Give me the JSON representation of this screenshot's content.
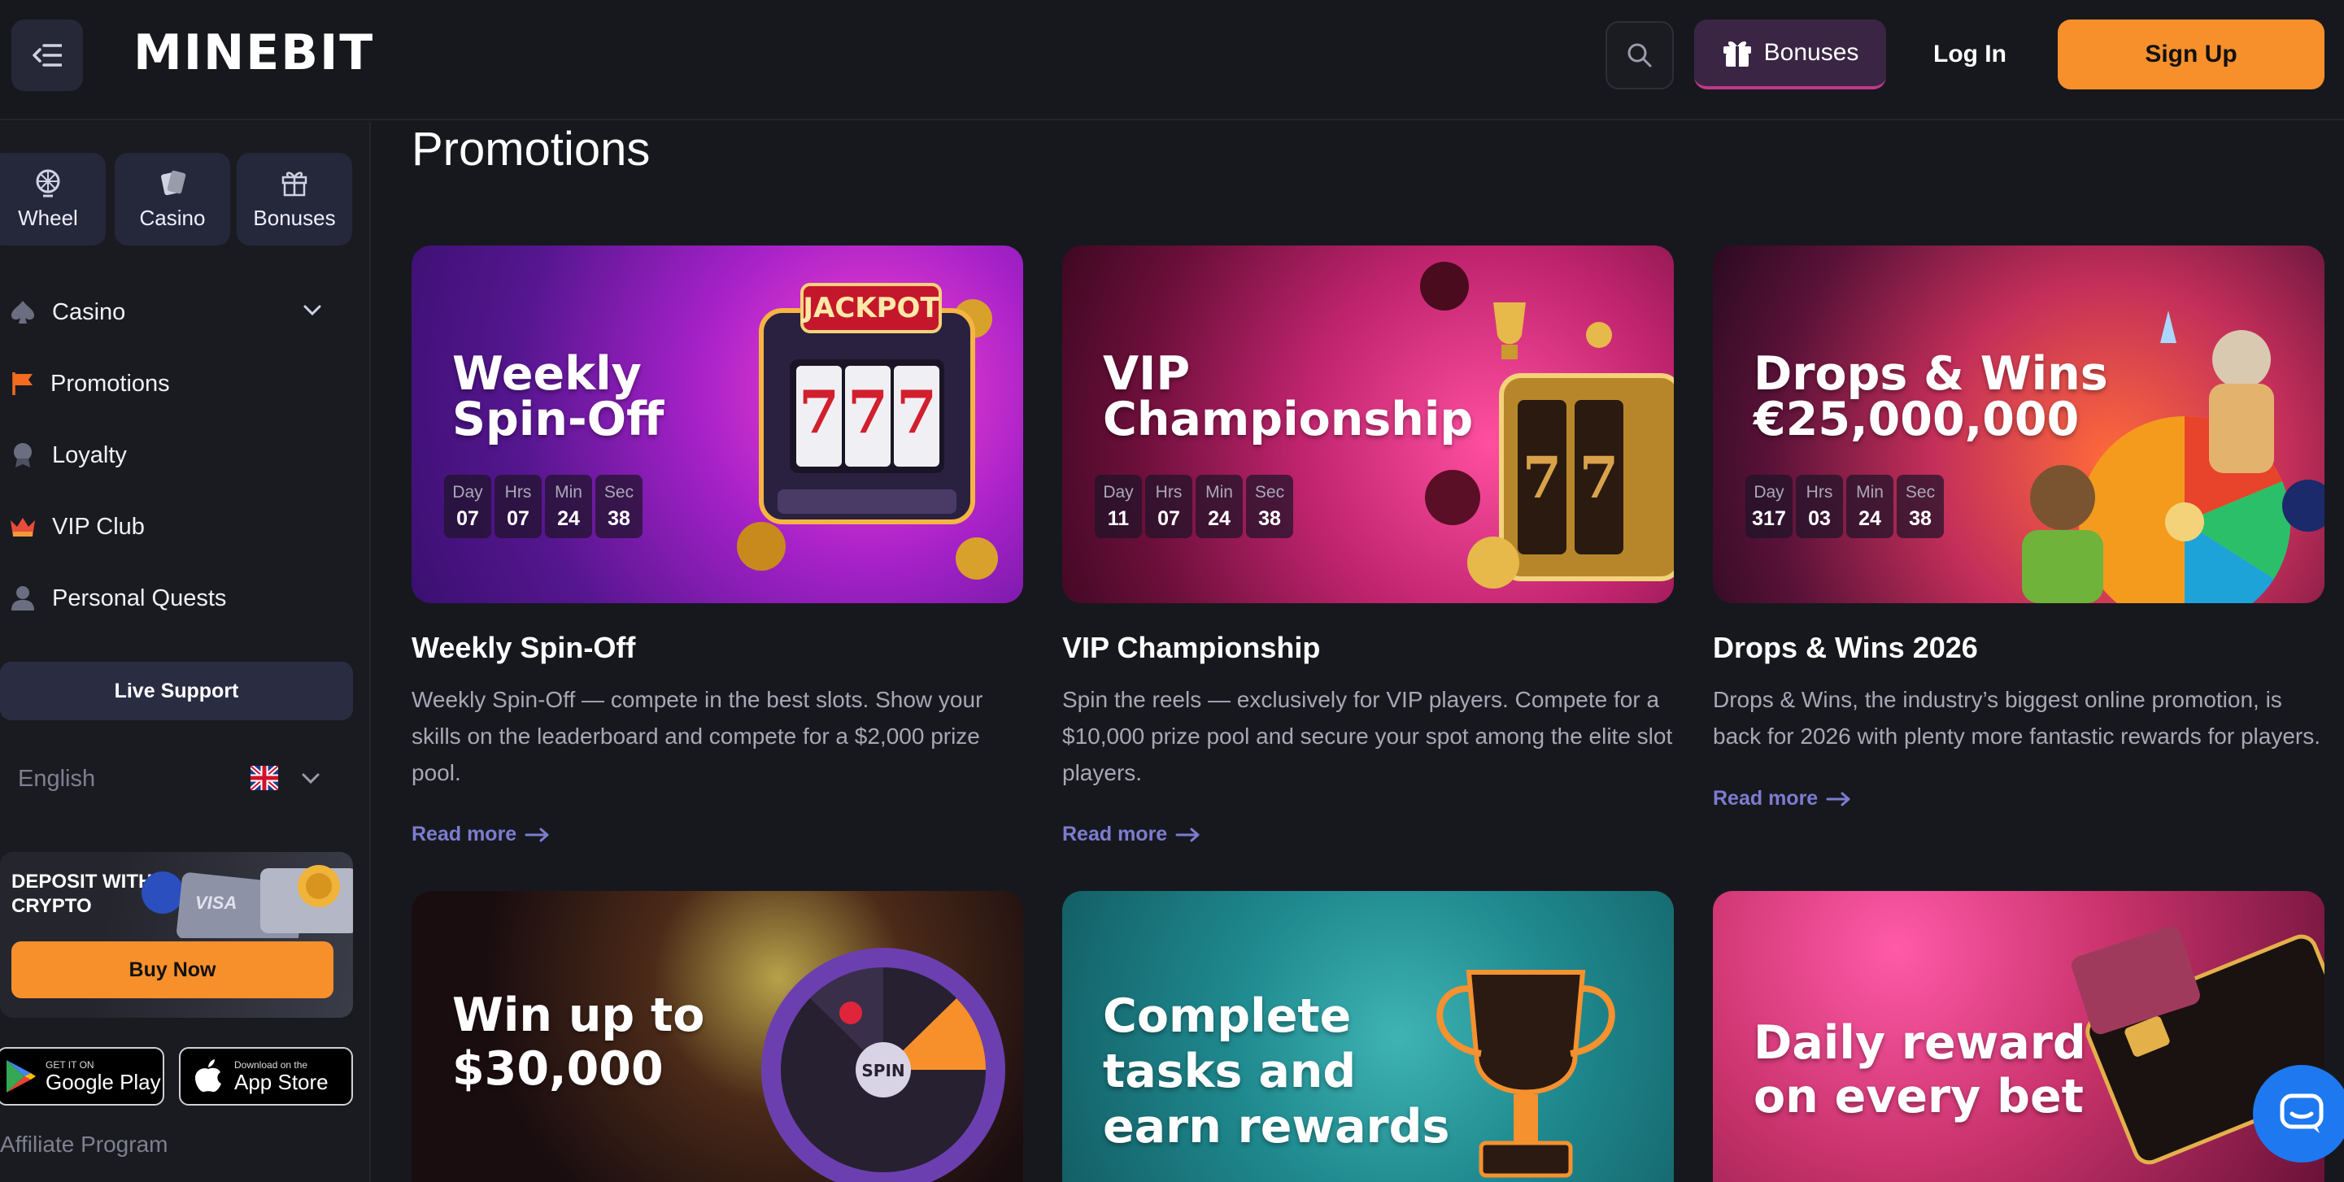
{
  "header": {
    "logo": "MINEBIT",
    "bonuses_label": "Bonuses",
    "login_label": "Log In",
    "signup_label": "Sign Up"
  },
  "sidebar": {
    "quick": [
      {
        "label": "Wheel",
        "icon": "wheel-icon"
      },
      {
        "label": "Casino",
        "icon": "cards-icon"
      },
      {
        "label": "Bonuses",
        "icon": "gift-icon"
      }
    ],
    "nav": [
      {
        "label": "Casino",
        "icon": "spade-icon"
      },
      {
        "label": "Promotions",
        "icon": "flag-icon"
      },
      {
        "label": "Loyalty",
        "icon": "medal-icon"
      },
      {
        "label": "VIP Club",
        "icon": "crown-icon"
      },
      {
        "label": "Personal Quests",
        "icon": "user-icon"
      }
    ],
    "live_support": "Live Support",
    "language": "English",
    "promo": {
      "title": "DEPOSIT WITH CRYPTO",
      "button": "Buy Now"
    },
    "stores": {
      "google_small": "GET IT ON",
      "google_big": "Google Play",
      "apple_small": "Download on the",
      "apple_big": "App Store"
    },
    "affiliate": "Affiliate Program"
  },
  "main": {
    "title": "Promotions",
    "timer_labels": [
      "Day",
      "Hrs",
      "Min",
      "Sec"
    ],
    "read_more": "Read more",
    "cards": [
      {
        "banner_line1": "Weekly",
        "banner_line2": "Spin-Off",
        "timer": [
          "07",
          "07",
          "24",
          "38"
        ],
        "title": "Weekly Spin-Off",
        "desc": "Weekly Spin-Off — compete in the best slots. Show your skills on the leaderboard and compete for a $2,000 prize pool.",
        "jackpot": "JACKPOT",
        "reels": "777"
      },
      {
        "banner_line1": "VIP",
        "banner_line2": "Championship",
        "timer": [
          "11",
          "07",
          "24",
          "38"
        ],
        "title": "VIP Championship",
        "desc": "Spin the reels — exclusively for VIP players. Compete for a $10,000 prize pool and secure your spot among the elite slot players."
      },
      {
        "banner_line1": "Drops & Wins",
        "banner_line2": "€25,000,000",
        "timer": [
          "317",
          "03",
          "24",
          "38"
        ],
        "title": "Drops & Wins 2026",
        "desc": "Drops & Wins, the industry’s biggest online promotion, is back for 2026 with plenty more fantastic rewards for players."
      },
      {
        "banner_line1": "Win up to",
        "banner_line2": "$30,000",
        "wheel_center": "SPIN"
      },
      {
        "banner_line1": "Complete",
        "banner_line2": "tasks and",
        "banner_line3": "earn rewards"
      },
      {
        "banner_line1": "Daily reward",
        "banner_line2": "on every bet"
      }
    ]
  },
  "colors": {
    "background": "#17181d",
    "accent_orange": "#f7902b",
    "link": "#7c7cd0",
    "bonus_accent": "#c2378a",
    "chat": "#1e78f0"
  }
}
